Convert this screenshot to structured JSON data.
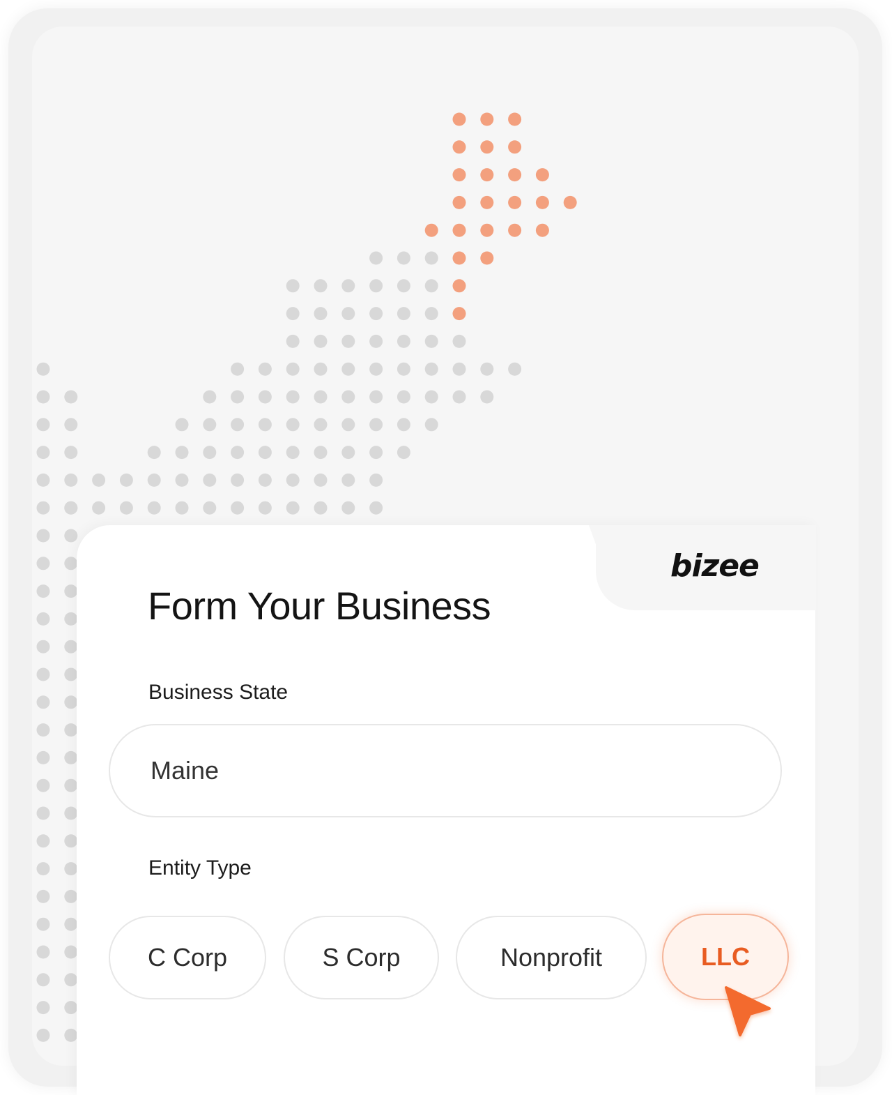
{
  "brand": {
    "logo_text": "bizee"
  },
  "form": {
    "title": "Form Your Business",
    "business_state": {
      "label": "Business State",
      "value": "Maine"
    },
    "entity_type": {
      "label": "Entity Type",
      "options": [
        {
          "label": "C Corp",
          "selected": false
        },
        {
          "label": "S Corp",
          "selected": false
        },
        {
          "label": "Nonprofit",
          "selected": false
        },
        {
          "label": "LLC",
          "selected": true
        }
      ]
    }
  },
  "colors": {
    "accent": "#e85c22",
    "dot_highlight": "#f3a07e",
    "dot_muted": "#d8d8d8",
    "background": "#f6f6f6"
  },
  "icons": {
    "cursor": "pointer-arrow-icon",
    "map": "dot-map-illustration"
  }
}
